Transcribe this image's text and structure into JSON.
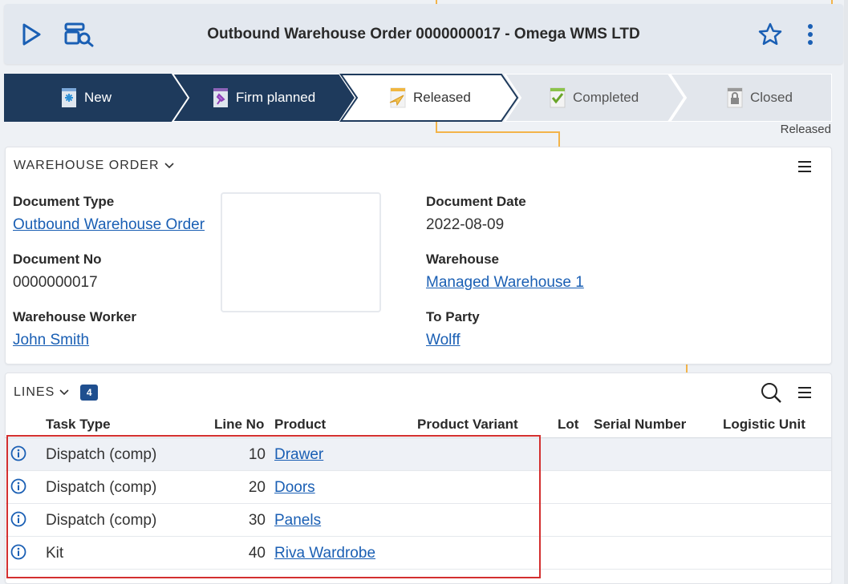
{
  "header": {
    "title": "Outbound Warehouse Order 0000000017 - Omega WMS LTD",
    "icons": [
      "play-icon",
      "search-document-icon",
      "star-icon",
      "more-vertical-icon"
    ]
  },
  "statusbar": {
    "steps": [
      {
        "label": "New",
        "state": "done",
        "icon": "new-document-icon"
      },
      {
        "label": "Firm planned",
        "state": "done",
        "icon": "pin-document-icon"
      },
      {
        "label": "Released",
        "state": "active",
        "icon": "send-document-icon"
      },
      {
        "label": "Completed",
        "state": "pending",
        "icon": "check-document-icon"
      },
      {
        "label": "Closed",
        "state": "pending",
        "icon": "lock-document-icon"
      }
    ],
    "current": "Released",
    "colors": {
      "done": "#1e3a5c",
      "active": "#ffffff",
      "pending": "#e2e6ec"
    }
  },
  "warehouse_order": {
    "title": "WAREHOUSE ORDER",
    "fields": {
      "document_type": {
        "label": "Document Type",
        "value": "Outbound Warehouse Order"
      },
      "document_date": {
        "label": "Document Date",
        "value": "2022-08-09"
      },
      "document_no": {
        "label": "Document No",
        "value": "0000000017"
      },
      "warehouse": {
        "label": "Warehouse",
        "value": "Managed Warehouse 1"
      },
      "warehouse_worker": {
        "label": "Warehouse Worker",
        "value": "John Smith"
      },
      "to_party": {
        "label": "To Party",
        "value": "Wolff"
      }
    }
  },
  "lines": {
    "title": "LINES",
    "count": "4",
    "columns": [
      "Task Type",
      "Line No",
      "Product",
      "Product Variant",
      "Lot",
      "Serial Number",
      "Logistic Unit"
    ],
    "rows": [
      {
        "task_type": "Dispatch (comp)",
        "line_no": "10",
        "product": "Drawer"
      },
      {
        "task_type": "Dispatch (comp)",
        "line_no": "20",
        "product": "Doors"
      },
      {
        "task_type": "Dispatch (comp)",
        "line_no": "30",
        "product": "Panels"
      },
      {
        "task_type": "Kit",
        "line_no": "40",
        "product": "Riva Wardrobe"
      }
    ]
  },
  "accent_color": "#1a5fb4",
  "highlight_color": "#d32f2f"
}
